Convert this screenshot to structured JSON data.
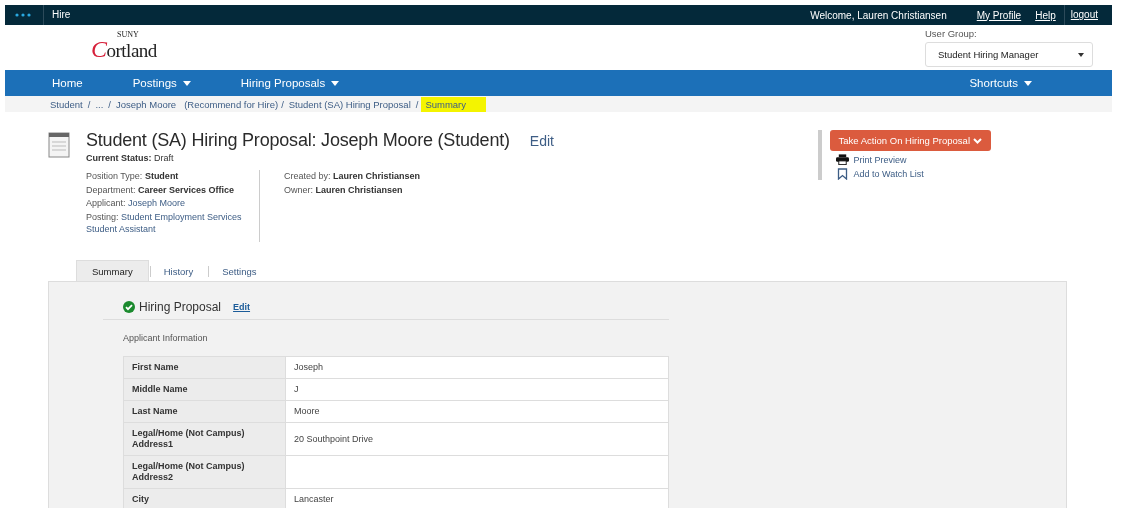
{
  "top_bar": {
    "app_title": "Hire",
    "welcome": "Welcome, Lauren Christiansen",
    "links": [
      "My Profile",
      "Help",
      "logout"
    ]
  },
  "logo": {
    "small": "SUNY",
    "name": "Cortland"
  },
  "user_group": {
    "label": "User Group:",
    "value": "Student Hiring Manager"
  },
  "nav": {
    "items": [
      {
        "label": "Home",
        "dropdown": false
      },
      {
        "label": "Postings",
        "dropdown": true
      },
      {
        "label": "Hiring Proposals",
        "dropdown": true
      }
    ],
    "right": {
      "label": "Shortcuts",
      "dropdown": true
    }
  },
  "breadcrumb": {
    "separator": "/",
    "items": [
      {
        "label": "Student",
        "highlighted": false
      },
      {
        "label": "...",
        "highlighted": false
      },
      {
        "label": "Joseph Moore",
        "note": "(Recommend for Hire)",
        "highlighted": false
      },
      {
        "label": "Student (SA) Hiring Proposal",
        "highlighted": false
      },
      {
        "label": "Summary",
        "highlighted": true
      }
    ]
  },
  "header": {
    "title": "Student (SA) Hiring Proposal: Joseph Moore (Student)",
    "edit": "Edit",
    "status_label": "Current Status:",
    "status": "Draft"
  },
  "details_left": [
    {
      "label": "Position Type:",
      "value": "Student",
      "kind": "bold"
    },
    {
      "label": "Department:",
      "value": "Career Services Office",
      "kind": "bold"
    },
    {
      "label": "Applicant:",
      "value": "Joseph Moore",
      "kind": "link"
    },
    {
      "label": "Posting:",
      "value": "Student Employment Services Student Assistant",
      "kind": "link"
    }
  ],
  "details_right": [
    {
      "label": "Created by:",
      "value": "Lauren Christiansen"
    },
    {
      "label": "Owner:",
      "value": "Lauren Christiansen"
    }
  ],
  "actions": {
    "button": "Take Action On Hiring Proposal",
    "links": [
      {
        "label": "Print Preview",
        "kind": "print"
      },
      {
        "label": "Add to Watch List",
        "kind": "bookmark"
      }
    ]
  },
  "tabs": [
    {
      "label": "Summary",
      "selected": true
    },
    {
      "label": "History",
      "selected": false
    },
    {
      "label": "Settings",
      "selected": false
    }
  ],
  "section": {
    "title": "Hiring Proposal",
    "complete": true,
    "edit": "Edit",
    "subtitle": "Applicant Information",
    "rows": [
      {
        "label": "First Name",
        "value": "Joseph"
      },
      {
        "label": "Middle Name",
        "value": "J"
      },
      {
        "label": "Last Name",
        "value": "Moore"
      },
      {
        "label": "Legal/Home (Not Campus) Address1",
        "value": "20 Southpoint Drive"
      },
      {
        "label": "Legal/Home (Not Campus) Address2",
        "value": ""
      },
      {
        "label": "City",
        "value": "Lancaster"
      }
    ]
  }
}
